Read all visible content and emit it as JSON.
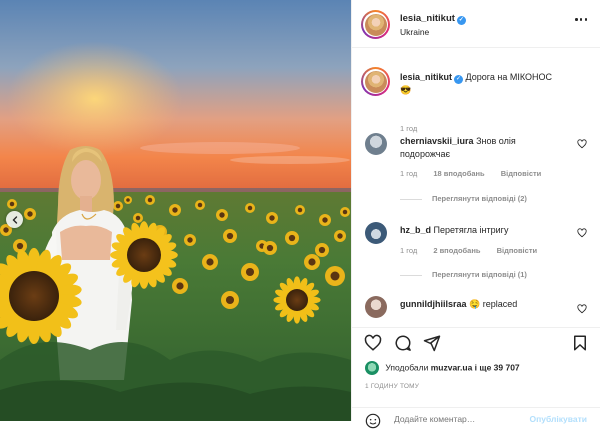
{
  "post": {
    "image_alt": "photo-sunflower-field-sunset",
    "prev_icon": "chevron-left-icon"
  },
  "header": {
    "username": "lesia_nitikut",
    "location": "Ukraine",
    "verified_icon": "verified-badge-icon",
    "more_icon": "more-options-icon"
  },
  "caption": {
    "username": "lesia_nitikut",
    "text": "Дорога на МІКОНОС",
    "emoji": "😎",
    "time": "1 год"
  },
  "comments": [
    {
      "username": "cherniavskii_iura",
      "text": "Знов олія подорожчає",
      "time": "1 год",
      "likes": "18 вподобань",
      "reply_label": "Відповісти",
      "thread_label": "Переглянути відповіді (2)"
    },
    {
      "username": "hz_b_d",
      "text": "Перетягла інтригу",
      "time": "1 год",
      "likes": "2 вподобань",
      "reply_label": "Відповісти",
      "thread_label": "Переглянути відповіді (1)"
    },
    {
      "username": "gunnildjhiilsraa",
      "text": "replaced",
      "emoji": "🤤"
    }
  ],
  "actions": {
    "like_icon": "heart-icon",
    "comment_icon": "comment-icon",
    "share_icon": "send-icon",
    "save_icon": "bookmark-icon",
    "likes_prefix": "Уподобали",
    "likes_user": "muzvar.ua",
    "likes_suffix": "і ще 39 707",
    "time_ago": "1 ГОДИНУ ТОМУ"
  },
  "add_comment": {
    "placeholder": "Додайте коментар…",
    "publish_label": "Опублікувати",
    "emoji_icon": "emoji-smile-icon"
  },
  "colors": {
    "accent_blue": "#3897f0",
    "publish_disabled": "#b2dffc",
    "muted_text": "#8e8e8e"
  }
}
